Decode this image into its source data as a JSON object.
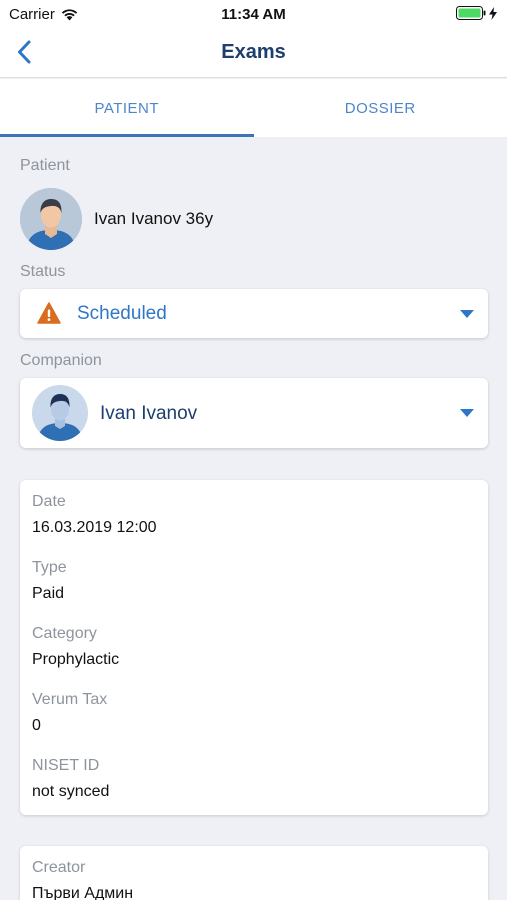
{
  "status_bar": {
    "carrier": "Carrier",
    "time": "11:34 AM"
  },
  "nav": {
    "title": "Exams"
  },
  "tabs": [
    {
      "label": "PATIENT",
      "active": true
    },
    {
      "label": "DOSSIER",
      "active": false
    }
  ],
  "patient": {
    "section_label": "Patient",
    "name": "Ivan Ivanov 36y"
  },
  "status": {
    "section_label": "Status",
    "value": "Scheduled",
    "color": "#2f76c8",
    "icon": "warning-icon",
    "icon_color": "#d96c1f"
  },
  "companion": {
    "section_label": "Companion",
    "value": "Ivan Ivanov"
  },
  "details": [
    {
      "label": "Date",
      "value": "16.03.2019 12:00"
    },
    {
      "label": "Type",
      "value": "Paid"
    },
    {
      "label": "Category",
      "value": "Prophylactic"
    },
    {
      "label": "Verum Tax",
      "value": "0"
    },
    {
      "label": "NISET ID",
      "value": "not synced"
    }
  ],
  "creator": {
    "label": "Creator",
    "value": "Първи Админ"
  },
  "colors": {
    "accent": "#2f76c8",
    "title": "#1d3f6e",
    "background": "#eef0f5"
  }
}
